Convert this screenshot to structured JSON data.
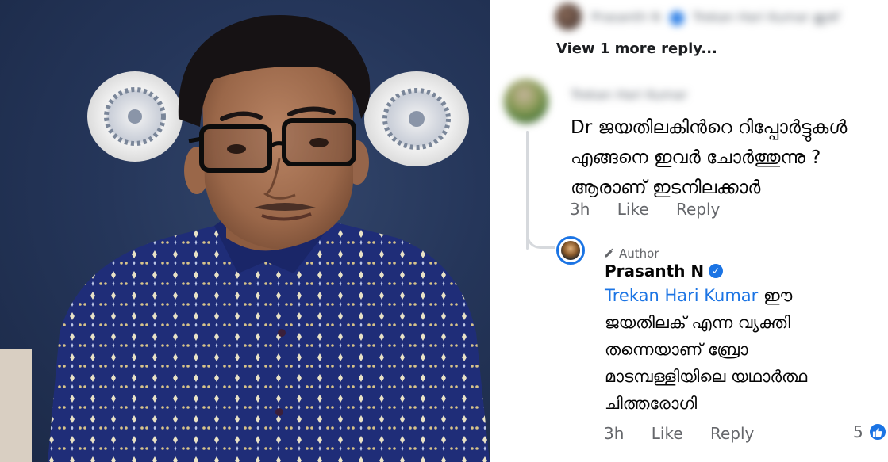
{
  "top_reply": {
    "name": "Prasanth N",
    "text": "Trekan Hari Kumar ഇത്"
  },
  "view_more_label": "View 1 more reply...",
  "comment": {
    "author": "Trekan Hari Kumar",
    "lines": [
      "Dr ജയതിലകിൻറെ റിപ്പോർട്ടുകൾ",
      "എങ്ങനെ ഇവർ ചോർത്തുന്നു ?",
      "ആരാണ് ഇടനിലക്കാർ"
    ],
    "time": "3h",
    "like_label": "Like",
    "reply_label": "Reply"
  },
  "reply": {
    "badge": "Author",
    "author": "Prasanth N",
    "mention": "Trekan Hari Kumar",
    "first_line_rest": " ഈ",
    "lines": [
      "ജയതിലക് എന്ന വ്യക്തി",
      "തന്നെയാണ് ബ്രോ",
      "മാടമ്പള്ളിയിലെ യഥാർത്ഥ",
      "ചിത്തരോഗി"
    ],
    "time": "3h",
    "like_label": "Like",
    "reply_label": "Reply",
    "reaction_count": "5"
  },
  "icons": {
    "verified": "verified-check-icon",
    "author": "pencil-icon",
    "reaction": "thumbs-up-icon"
  },
  "colors": {
    "link": "#1b74e4",
    "meta": "#65676b",
    "thread": "#d6d9dd",
    "wall": "#25365a",
    "shirt": "#1e2a6e"
  }
}
